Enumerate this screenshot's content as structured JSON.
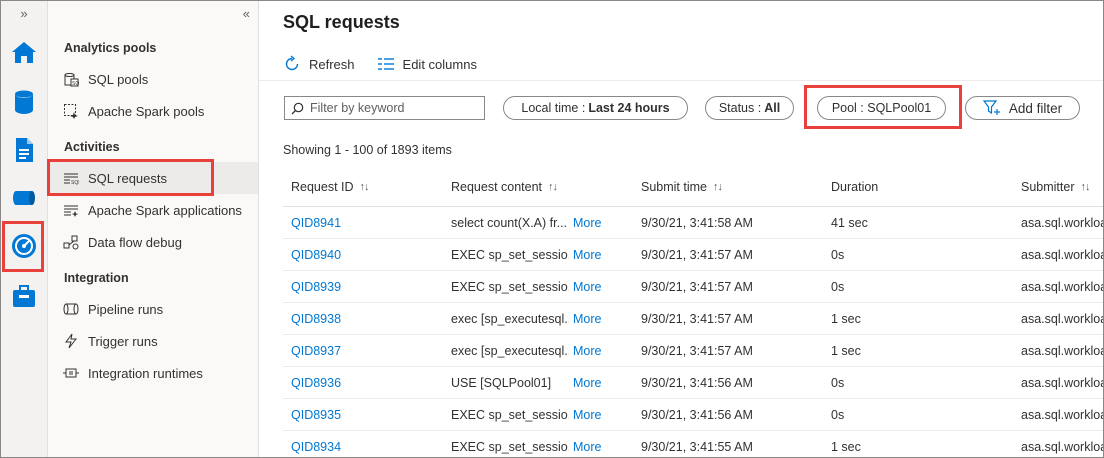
{
  "rail": {
    "expand_glyph": "»",
    "icons": [
      "home-icon",
      "data-icon",
      "develop-icon",
      "integrate-icon",
      "monitor-icon",
      "manage-icon"
    ]
  },
  "nav": {
    "collapse_glyph": "«",
    "sections": {
      "analytics": "Analytics pools",
      "activities": "Activities",
      "integration": "Integration"
    },
    "items": {
      "sql_pools": "SQL pools",
      "spark_pools": "Apache Spark pools",
      "sql_requests": "SQL requests",
      "spark_apps": "Apache Spark applications",
      "dataflow_debug": "Data flow debug",
      "pipeline_runs": "Pipeline runs",
      "trigger_runs": "Trigger runs",
      "integration_runtimes": "Integration runtimes"
    }
  },
  "main": {
    "title": "SQL requests",
    "toolbar": {
      "refresh": "Refresh",
      "edit_columns": "Edit columns"
    },
    "search_placeholder": "Filter by keyword",
    "filters": {
      "time_label": "Local time :",
      "time_value": "Last 24 hours",
      "status_label": "Status :",
      "status_value": "All",
      "pool": "Pool : SQLPool01",
      "add_filter": "Add filter"
    },
    "showing": "Showing 1 - 100 of 1893 items",
    "columns": [
      "Request ID",
      "Request content",
      "Submit time",
      "Duration",
      "Submitter"
    ],
    "more_label": "More"
  },
  "rows": [
    {
      "id": "QID8941",
      "content": "select count(X.A) fr...",
      "time": "9/30/21, 3:41:58 AM",
      "duration": "41 sec",
      "submitter": "asa.sql.workload"
    },
    {
      "id": "QID8940",
      "content": "EXEC sp_set_sessio...",
      "time": "9/30/21, 3:41:57 AM",
      "duration": "0s",
      "submitter": "asa.sql.workload"
    },
    {
      "id": "QID8939",
      "content": "EXEC sp_set_sessio...",
      "time": "9/30/21, 3:41:57 AM",
      "duration": "0s",
      "submitter": "asa.sql.workload"
    },
    {
      "id": "QID8938",
      "content": "exec [sp_executesql...",
      "time": "9/30/21, 3:41:57 AM",
      "duration": "1 sec",
      "submitter": "asa.sql.workload"
    },
    {
      "id": "QID8937",
      "content": "exec [sp_executesql...",
      "time": "9/30/21, 3:41:57 AM",
      "duration": "1 sec",
      "submitter": "asa.sql.workload"
    },
    {
      "id": "QID8936",
      "content": "USE [SQLPool01]",
      "time": "9/30/21, 3:41:56 AM",
      "duration": "0s",
      "submitter": "asa.sql.workload"
    },
    {
      "id": "QID8935",
      "content": "EXEC sp_set_sessio...",
      "time": "9/30/21, 3:41:56 AM",
      "duration": "0s",
      "submitter": "asa.sql.workload"
    },
    {
      "id": "QID8934",
      "content": "EXEC sp_set_sessio...",
      "time": "9/30/21, 3:41:55 AM",
      "duration": "1 sec",
      "submitter": "asa.sql.workload"
    }
  ],
  "colors": {
    "highlight": "#e8413b",
    "link": "#0078d4",
    "icon_blue": "#0078d4"
  }
}
